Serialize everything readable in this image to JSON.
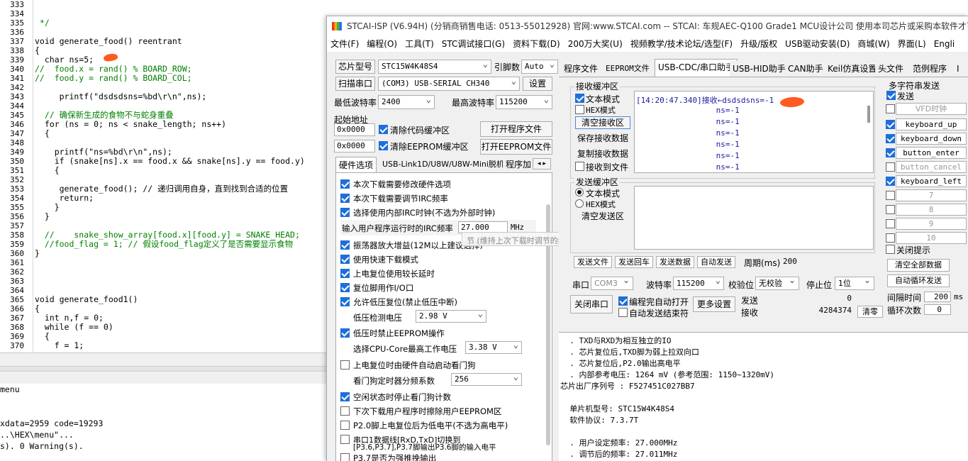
{
  "editor": {
    "line_numbers": [
      "333",
      "334",
      "335",
      "336",
      "337",
      "338",
      "339",
      "340",
      "341",
      "342",
      "343",
      "344",
      "345",
      "346",
      "347",
      "348",
      "349",
      "350",
      "351",
      "352",
      "353",
      "354",
      "355",
      "356",
      "357",
      "358",
      "359",
      "360",
      "361",
      "362",
      "363",
      "364",
      "365",
      "366",
      "367",
      "368",
      "369",
      "370"
    ],
    "lines": [
      "",
      "",
      " */",
      "",
      "void generate_food() reentrant",
      "{",
      "  char ns=5;",
      "//  food.x = rand() % BOARD_ROW;",
      "//  food.y = rand() % BOARD_COL;",
      "",
      "     printf(\"dsdsdsns=%bd\\r\\n\",ns);",
      "",
      "  // 确保新生成的食物不与蛇身重叠",
      "  for (ns = 0; ns < snake_length; ns++)",
      "  {",
      "",
      "    printf(\"ns=%bd\\r\\n\",ns);",
      "    if (snake[ns].x == food.x && snake[ns].y == food.y)",
      "    {",
      "",
      "     generate_food(); // 递归调用自身，直到找到合适的位置",
      "     return;",
      "    }",
      "  }",
      "",
      "  //    snake_show_array[food.x][food.y] = SNAKE_HEAD;",
      "  //food_flag = 1; // 假设food_flag定义了是否需要显示食物",
      "}",
      "",
      "",
      "",
      "",
      "void generate_food1()",
      "{",
      "  int n,f = 0;",
      "  while (f == 0)",
      "  {",
      "    f = 1;"
    ]
  },
  "output": {
    "lines": [
      "menu",
      "",
      "",
      "xdata=2959 code=19293",
      "..\\HEX\\menu\"...",
      "s). 0 Warning(s)."
    ]
  },
  "isp": {
    "title": "STCAI-ISP (V6.94H) (分销商销售电话: 0513-55012928) 官网:www.STCAI.com  -- STCAI: 车规AEC-Q100 Grade1 MCU设计公司 使用本司芯片或采购本软件才可使用本软件",
    "menu": [
      "文件(F)",
      "编程(O)",
      "工具(T)",
      "STC调试接口(G)",
      "资料下载(D)",
      "200万大奖(U)",
      "视频教学/技术论坛/选型(F)",
      "升级/版权",
      "USB驱动安装(D)",
      "商城(W)",
      "界面(L)",
      "Engli"
    ],
    "chip_label": "芯片型号",
    "chip_value": "STC15W4K48S4",
    "pins_label": "引脚数",
    "pins_value": "Auto",
    "scan_btn": "扫描串口",
    "port_value": "(COM3) USB-SERIAL CH340",
    "settings_btn": "设置",
    "min_baud_label": "最低波特率",
    "min_baud_value": "2400",
    "max_baud_label": "最高波特率",
    "max_baud_value": "115200",
    "start_addr_label": "起始地址",
    "addr1": "0x0000",
    "clear_code": "清除代码缓冲区",
    "open_prog": "打开程序文件",
    "addr2": "0x0000",
    "clear_eeprom": "清除EEPROM缓冲区",
    "open_eeprom": "打开EEPROM文件",
    "left_tabs": [
      "硬件选项",
      "USB-Link1D/U8W/U8W-Mini脱机",
      "程序加"
    ],
    "options": [
      {
        "label": "本次下载需要修改硬件选项",
        "checked": true
      },
      {
        "label": "本次下载需要调节IRC频率",
        "checked": true
      },
      {
        "label": "选择使用内部IRC时钟(不选为外部时钟)",
        "checked": true
      }
    ],
    "irc_label": "输入用户程序运行时的IRC频率",
    "irc_value": "27.000",
    "irc_unit": "MHz",
    "irc_tooltip": "节 (维持上次下载时调节的频率)",
    "options2": [
      {
        "label": "振荡器放大增益(12M以上建议选择)",
        "checked": true
      },
      {
        "label": "使用快速下载模式",
        "checked": true
      },
      {
        "label": "上电复位使用较长延时",
        "checked": true
      },
      {
        "label": "复位脚用作I/O口",
        "checked": true
      },
      {
        "label": "允许低压复位(禁止低压中断)",
        "checked": true
      }
    ],
    "lvd_label": "低压检测电压",
    "lvd_value": "2.98 V",
    "eeprom_low": {
      "label": "低压时禁止EEPROM操作",
      "checked": true
    },
    "cpu_v_label": "选择CPU-Core最高工作电压",
    "cpu_v_value": "3.38 V",
    "wdt_auto": {
      "label": "上电复位时由硬件自动启动看门狗",
      "checked": false
    },
    "wdt_div_label": "看门狗定时器分频系数",
    "wdt_div_value": "256",
    "options3": [
      {
        "label": "空闲状态时停止看门狗计数",
        "checked": true
      },
      {
        "label": "下次下载用户程序时擦除用户EEPROM区",
        "checked": false
      },
      {
        "label": "P2.0脚上电复位后为低电平(不选为高电平)",
        "checked": false
      },
      {
        "label": "串口1数据线[RxD,TxD]切换到",
        "checked": false
      },
      {
        "label": "P3.7是否为强推挽输出",
        "checked": false
      }
    ],
    "uart_switch_line2": "[P3.6,P3.7],P3.7脚输出P3.6脚的输入电平",
    "right_tabs": [
      "程序文件",
      "EEPROM文件",
      "USB-CDC/串口助手",
      "USB-HID助手",
      "CAN助手",
      "Keil仿真设置",
      "头文件",
      "范例程序",
      "I"
    ],
    "rx_group": "接收缓冲区",
    "rx_text_mode": "文本模式",
    "rx_hex_mode": "HEX模式",
    "rx_clear": "清空接收区",
    "rx_save": "保存接收数据",
    "rx_copy": "复制接收数据",
    "rx_to_file": "接收到文件",
    "rx_lines": [
      "[14:20:47.340]接收←dsdsdsns=-1",
      "                 ns=-1",
      "                 ns=-1",
      "                 ns=-1",
      "                 ns=-1",
      "                 ns=-1",
      "                 ns=-1"
    ],
    "tx_group": "发送缓冲区",
    "tx_text_mode": "文本模式",
    "tx_hex_mode": "HEX模式",
    "tx_clear": "清空发送区",
    "send_file": "发送文件",
    "send_return": "发送回车",
    "send_data": "发送数据",
    "auto_send": "自动发送",
    "period_label": "周期(ms)",
    "period_value": "200",
    "multi_group": "多字符串发送",
    "multi_send": "发送",
    "vfd_label": "VFD时钟",
    "multi_items": [
      {
        "label": "keyboard_up",
        "checked": true
      },
      {
        "label": "keyboard_down",
        "checked": true
      },
      {
        "label": "button_enter",
        "checked": true
      },
      {
        "label": "button_cancel",
        "checked": false
      },
      {
        "label": "keyboard_left",
        "checked": true
      },
      {
        "label": "7",
        "checked": false
      },
      {
        "label": "8",
        "checked": false
      },
      {
        "label": "9",
        "checked": false
      },
      {
        "label": "10",
        "checked": false
      }
    ],
    "close_hint": "关闭提示",
    "clear_all": "清空全部数据",
    "auto_loop": "自动循环发送",
    "interval_label": "间隔时间",
    "interval_value": "200",
    "interval_unit": "ms",
    "loop_label": "循环次数",
    "loop_value": "0",
    "serial_label": "串口",
    "serial_value": "COM3",
    "baud_label": "波特率",
    "baud_value": "115200",
    "parity_label": "校验位",
    "parity_value": "无校验",
    "stop_label": "停止位",
    "stop_value": "1位",
    "close_port": "关闭串口",
    "auto_open": "编程完自动打开",
    "auto_send_end": "自动发送结束符",
    "more_settings": "更多设置",
    "send_label": "发送",
    "send_count": "0",
    "recv_label": "接收",
    "recv_count": "4284374",
    "clear_counts": "清零",
    "info_lines": [
      "  . TXD与RXD为相互独立的IO",
      "  . 芯片复位后,TXD脚为弱上拉双向口",
      "  . 芯片复位后,P2.0输出高电平",
      "  . 内部参考电压: 1264 mV (参考范围: 1150~1320mV)",
      "芯片出厂序列号 : F527451C027BB7",
      "",
      "  单片机型号: STC15W4K48S4",
      "  软件协议: 7.3.7T",
      "",
      "  . 用户设定频率: 27.000MHz",
      "  . 调节后的频率: 27.011MHz"
    ]
  },
  "colors": {
    "accent": "#1e6fd9",
    "rx_text": "#1a1aa0",
    "annotation": "#ff5a1f"
  }
}
